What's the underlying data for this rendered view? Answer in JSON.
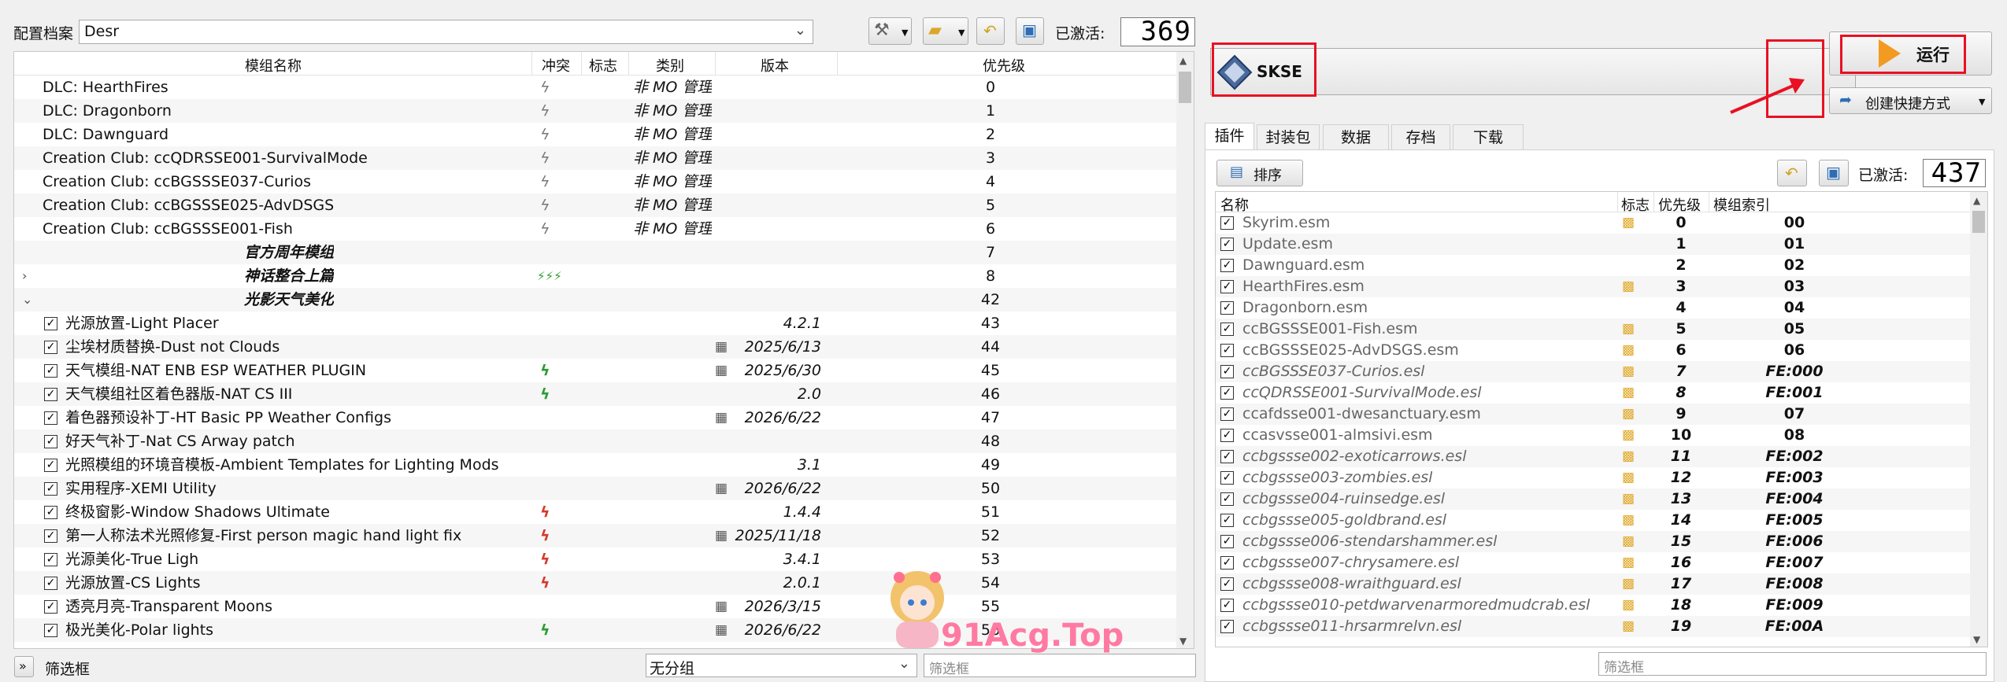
{
  "toolbar": {
    "profile_label": "配置档案",
    "profile_value": "Desr",
    "active_label": "已激活:",
    "active_count": "369"
  },
  "mod_list": {
    "headers": {
      "name": "模组名称",
      "conflict": "冲突",
      "flags": "标志",
      "category": "类别",
      "version": "版本",
      "priority": "优先级"
    },
    "rows": [
      {
        "name": "DLC: HearthFires",
        "category": "非 MO 管理",
        "priority": "0"
      },
      {
        "name": "DLC: Dragonborn",
        "category": "非 MO 管理",
        "priority": "1"
      },
      {
        "name": "DLC: Dawnguard",
        "category": "非 MO 管理",
        "priority": "2"
      },
      {
        "name": "Creation Club: ccQDRSSE001-SurvivalMode",
        "category": "非 MO 管理",
        "priority": "3"
      },
      {
        "name": "Creation Club: ccBGSSSE037-Curios",
        "category": "非 MO 管理",
        "priority": "4"
      },
      {
        "name": "Creation Club: ccBGSSSE025-AdvDSGS",
        "category": "非 MO 管理",
        "priority": "5"
      },
      {
        "name": "Creation Club: ccBGSSSE001-Fish",
        "category": "非 MO 管理",
        "priority": "6"
      },
      {
        "name": "官方周年模组",
        "priority": "7"
      },
      {
        "name": "神话整合上篇",
        "priority": "8"
      },
      {
        "name": "光影天气美化",
        "priority": "42"
      },
      {
        "name": "光源放置-Light Placer",
        "version": "4.2.1",
        "priority": "43"
      },
      {
        "name": "尘埃材质替换-Dust not Clouds",
        "version": "2025/6/13",
        "priority": "44"
      },
      {
        "name": "天气模组-NAT ENB ESP WEATHER PLUGIN",
        "version": "2025/6/30",
        "priority": "45"
      },
      {
        "name": "天气模组社区着色器版-NAT CS III",
        "version": "2.0",
        "priority": "46"
      },
      {
        "name": "着色器预设补丁-HT Basic PP Weather Configs",
        "version": "2026/6/22",
        "priority": "47"
      },
      {
        "name": "好天气补丁-Nat CS Arway patch",
        "priority": "48"
      },
      {
        "name": "光照模组的环境音模板-Ambient Templates for Lighting Mods",
        "version": "3.1",
        "priority": "49"
      },
      {
        "name": "实用程序-XEMI Utility",
        "version": "2026/6/22",
        "priority": "50"
      },
      {
        "name": "终极窗影-Window Shadows Ultimate",
        "version": "1.4.4",
        "priority": "51"
      },
      {
        "name": "第一人称法术光照修复-First person magic hand light fix",
        "version": "2025/11/18",
        "priority": "52"
      },
      {
        "name": "光源美化-True Ligh",
        "version": "3.4.1",
        "priority": "53"
      },
      {
        "name": "光源放置-CS Lights",
        "version": "2.0.1",
        "priority": "54"
      },
      {
        "name": "透亮月亮-Transparent Moons",
        "version": "2026/3/15",
        "priority": "55"
      },
      {
        "name": "极光美化-Polar lights",
        "version": "2026/6/22",
        "priority": "56"
      }
    ]
  },
  "bottom_bar": {
    "filter_label": "筛选框",
    "group_value": "无分组",
    "filter_placeholder": "筛选框"
  },
  "run_panel": {
    "executable": "SKSE",
    "run_label": "运行",
    "shortcut_label": "创建快捷方式"
  },
  "tabs": [
    "插件",
    "封装包",
    "数据",
    "存档",
    "下载"
  ],
  "plugins": {
    "sort_label": "排序",
    "active_label": "已激活:",
    "active_count": "437",
    "headers": {
      "name": "名称",
      "flags": "标志",
      "priority": "优先级",
      "index": "模组索引"
    },
    "filter_placeholder": "筛选框",
    "rows": [
      {
        "name": "Skyrim.esm",
        "priority": "0",
        "index": "00"
      },
      {
        "name": "Update.esm",
        "priority": "1",
        "index": "01"
      },
      {
        "name": "Dawnguard.esm",
        "priority": "2",
        "index": "02"
      },
      {
        "name": "HearthFires.esm",
        "priority": "3",
        "index": "03"
      },
      {
        "name": "Dragonborn.esm",
        "priority": "4",
        "index": "04"
      },
      {
        "name": "ccBGSSSE001-Fish.esm",
        "priority": "5",
        "index": "05"
      },
      {
        "name": "ccBGSSSE025-AdvDSGS.esm",
        "priority": "6",
        "index": "06"
      },
      {
        "name": "ccBGSSSE037-Curios.esl",
        "priority": "7",
        "index": "FE:000"
      },
      {
        "name": "ccQDRSSE001-SurvivalMode.esl",
        "priority": "8",
        "index": "FE:001"
      },
      {
        "name": "ccafdsse001-dwesanctuary.esm",
        "priority": "9",
        "index": "07"
      },
      {
        "name": "ccasvsse001-almsivi.esm",
        "priority": "10",
        "index": "08"
      },
      {
        "name": "ccbgssse002-exoticarrows.esl",
        "priority": "11",
        "index": "FE:002"
      },
      {
        "name": "ccbgssse003-zombies.esl",
        "priority": "12",
        "index": "FE:003"
      },
      {
        "name": "ccbgssse004-ruinsedge.esl",
        "priority": "13",
        "index": "FE:004"
      },
      {
        "name": "ccbgssse005-goldbrand.esl",
        "priority": "14",
        "index": "FE:005"
      },
      {
        "name": "ccbgssse006-stendarshammer.esl",
        "priority": "15",
        "index": "FE:006"
      },
      {
        "name": "ccbgssse007-chrysamere.esl",
        "priority": "16",
        "index": "FE:007"
      },
      {
        "name": "ccbgssse008-wraithguard.esl",
        "priority": "17",
        "index": "FE:008"
      },
      {
        "name": "ccbgssse010-petdwarvenarmoredmudcrab.esl",
        "priority": "18",
        "index": "FE:009"
      },
      {
        "name": "ccbgssse011-hrsarmrelvn.esl",
        "priority": "19",
        "index": "FE:00A"
      }
    ]
  },
  "watermark": "91Acg.Top",
  "colors": {
    "accent_red": "#e81123",
    "run_orange": "#f39a21"
  }
}
